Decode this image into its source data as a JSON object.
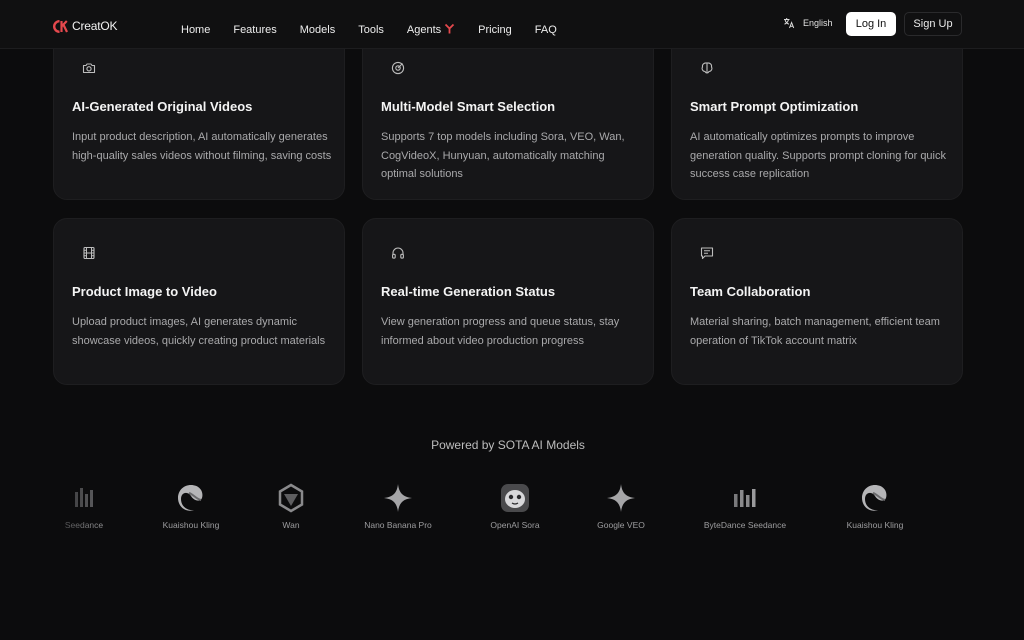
{
  "header": {
    "logo_text": "CreatOK",
    "nav": [
      {
        "label": "Home"
      },
      {
        "label": "Features"
      },
      {
        "label": "Models"
      },
      {
        "label": "Tools"
      },
      {
        "label": "Agents"
      },
      {
        "label": "Pricing"
      },
      {
        "label": "FAQ"
      }
    ],
    "language": "English",
    "login_label": "Log In",
    "signup_label": "Sign Up"
  },
  "features": [
    {
      "icon": "camera-icon",
      "title": "AI-Generated Original Videos",
      "desc": "Input product description, AI automatically generates high-quality sales videos without filming, saving costs"
    },
    {
      "icon": "target-icon",
      "title": "Multi-Model Smart Selection",
      "desc": "Supports 7 top models including Sora, VEO, Wan, CogVideoX, Hunyuan, automatically matching optimal solutions"
    },
    {
      "icon": "brain-icon",
      "title": "Smart Prompt Optimization",
      "desc": "AI automatically optimizes prompts to improve generation quality. Supports prompt cloning for quick success case replication"
    },
    {
      "icon": "film-icon",
      "title": "Product Image to Video",
      "desc": "Upload product images, AI generates dynamic showcase videos, quickly creating product materials"
    },
    {
      "icon": "headphones-icon",
      "title": "Real-time Generation Status",
      "desc": "View generation progress and queue status, stay informed about video production progress"
    },
    {
      "icon": "message-icon",
      "title": "Team Collaboration",
      "desc": "Material sharing, batch management, efficient team operation of TikTok account matrix"
    }
  ],
  "models": {
    "heading": "Powered by SOTA AI Models",
    "items": [
      {
        "name": "Seedance",
        "icon": "bars-icon"
      },
      {
        "name": "Kuaishou Kling",
        "icon": "kling-icon"
      },
      {
        "name": "Wan",
        "icon": "wan-icon"
      },
      {
        "name": "Nano Banana Pro",
        "icon": "sparkle-icon"
      },
      {
        "name": "OpenAI Sora",
        "icon": "sora-icon"
      },
      {
        "name": "Google VEO",
        "icon": "sparkle-icon"
      },
      {
        "name": "ByteDance Seedance",
        "icon": "bars-icon"
      },
      {
        "name": "Kuaishou Kling",
        "icon": "kling-icon"
      }
    ]
  },
  "colors": {
    "background": "#0c0c0d",
    "card": "#161618",
    "brand": "#e5484d"
  }
}
